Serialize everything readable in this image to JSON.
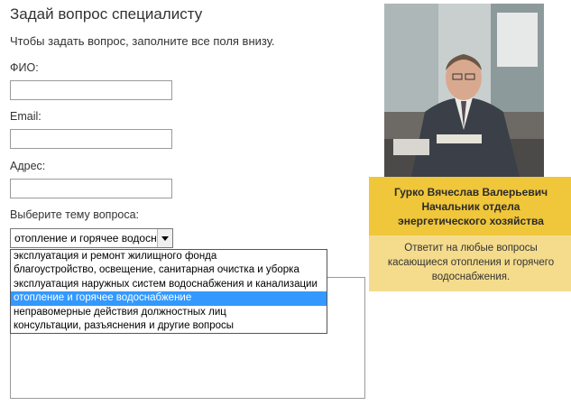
{
  "form": {
    "title": "Задай вопрос специалисту",
    "intro": "Чтобы задать вопрос, заполните все поля внизу.",
    "fio_label": "ФИО:",
    "email_label": "Email:",
    "address_label": "Адрес:",
    "topic_label": "Выберите тему вопроса:",
    "topic_selected": "отопление и горячее водоснабжение",
    "topic_options": [
      "эксплуатация и ремонт жилищного фонда",
      "благоустройство, освещение, санитарная очистка и уборка",
      "эксплуатация наружных систем водоснабжения и канализации",
      "отопление и горячее водоснабжение",
      "неправомерные действия должностных лиц",
      "консультации, разъяснения и другие вопросы"
    ],
    "selected_index": 3
  },
  "specialist": {
    "name": "Гурко Вячеслав Валерьевич",
    "position_line1": "Начальник отдела",
    "position_line2": "энергетического хозяйства",
    "desc_line1": "Ответит на любые вопросы",
    "desc_line2": "касающиеся отопления и горячего",
    "desc_line3": "водоснабжения."
  },
  "colors": {
    "accent": "#f0c63a",
    "accent_light": "#f5dc8c",
    "selection": "#3399ff"
  }
}
